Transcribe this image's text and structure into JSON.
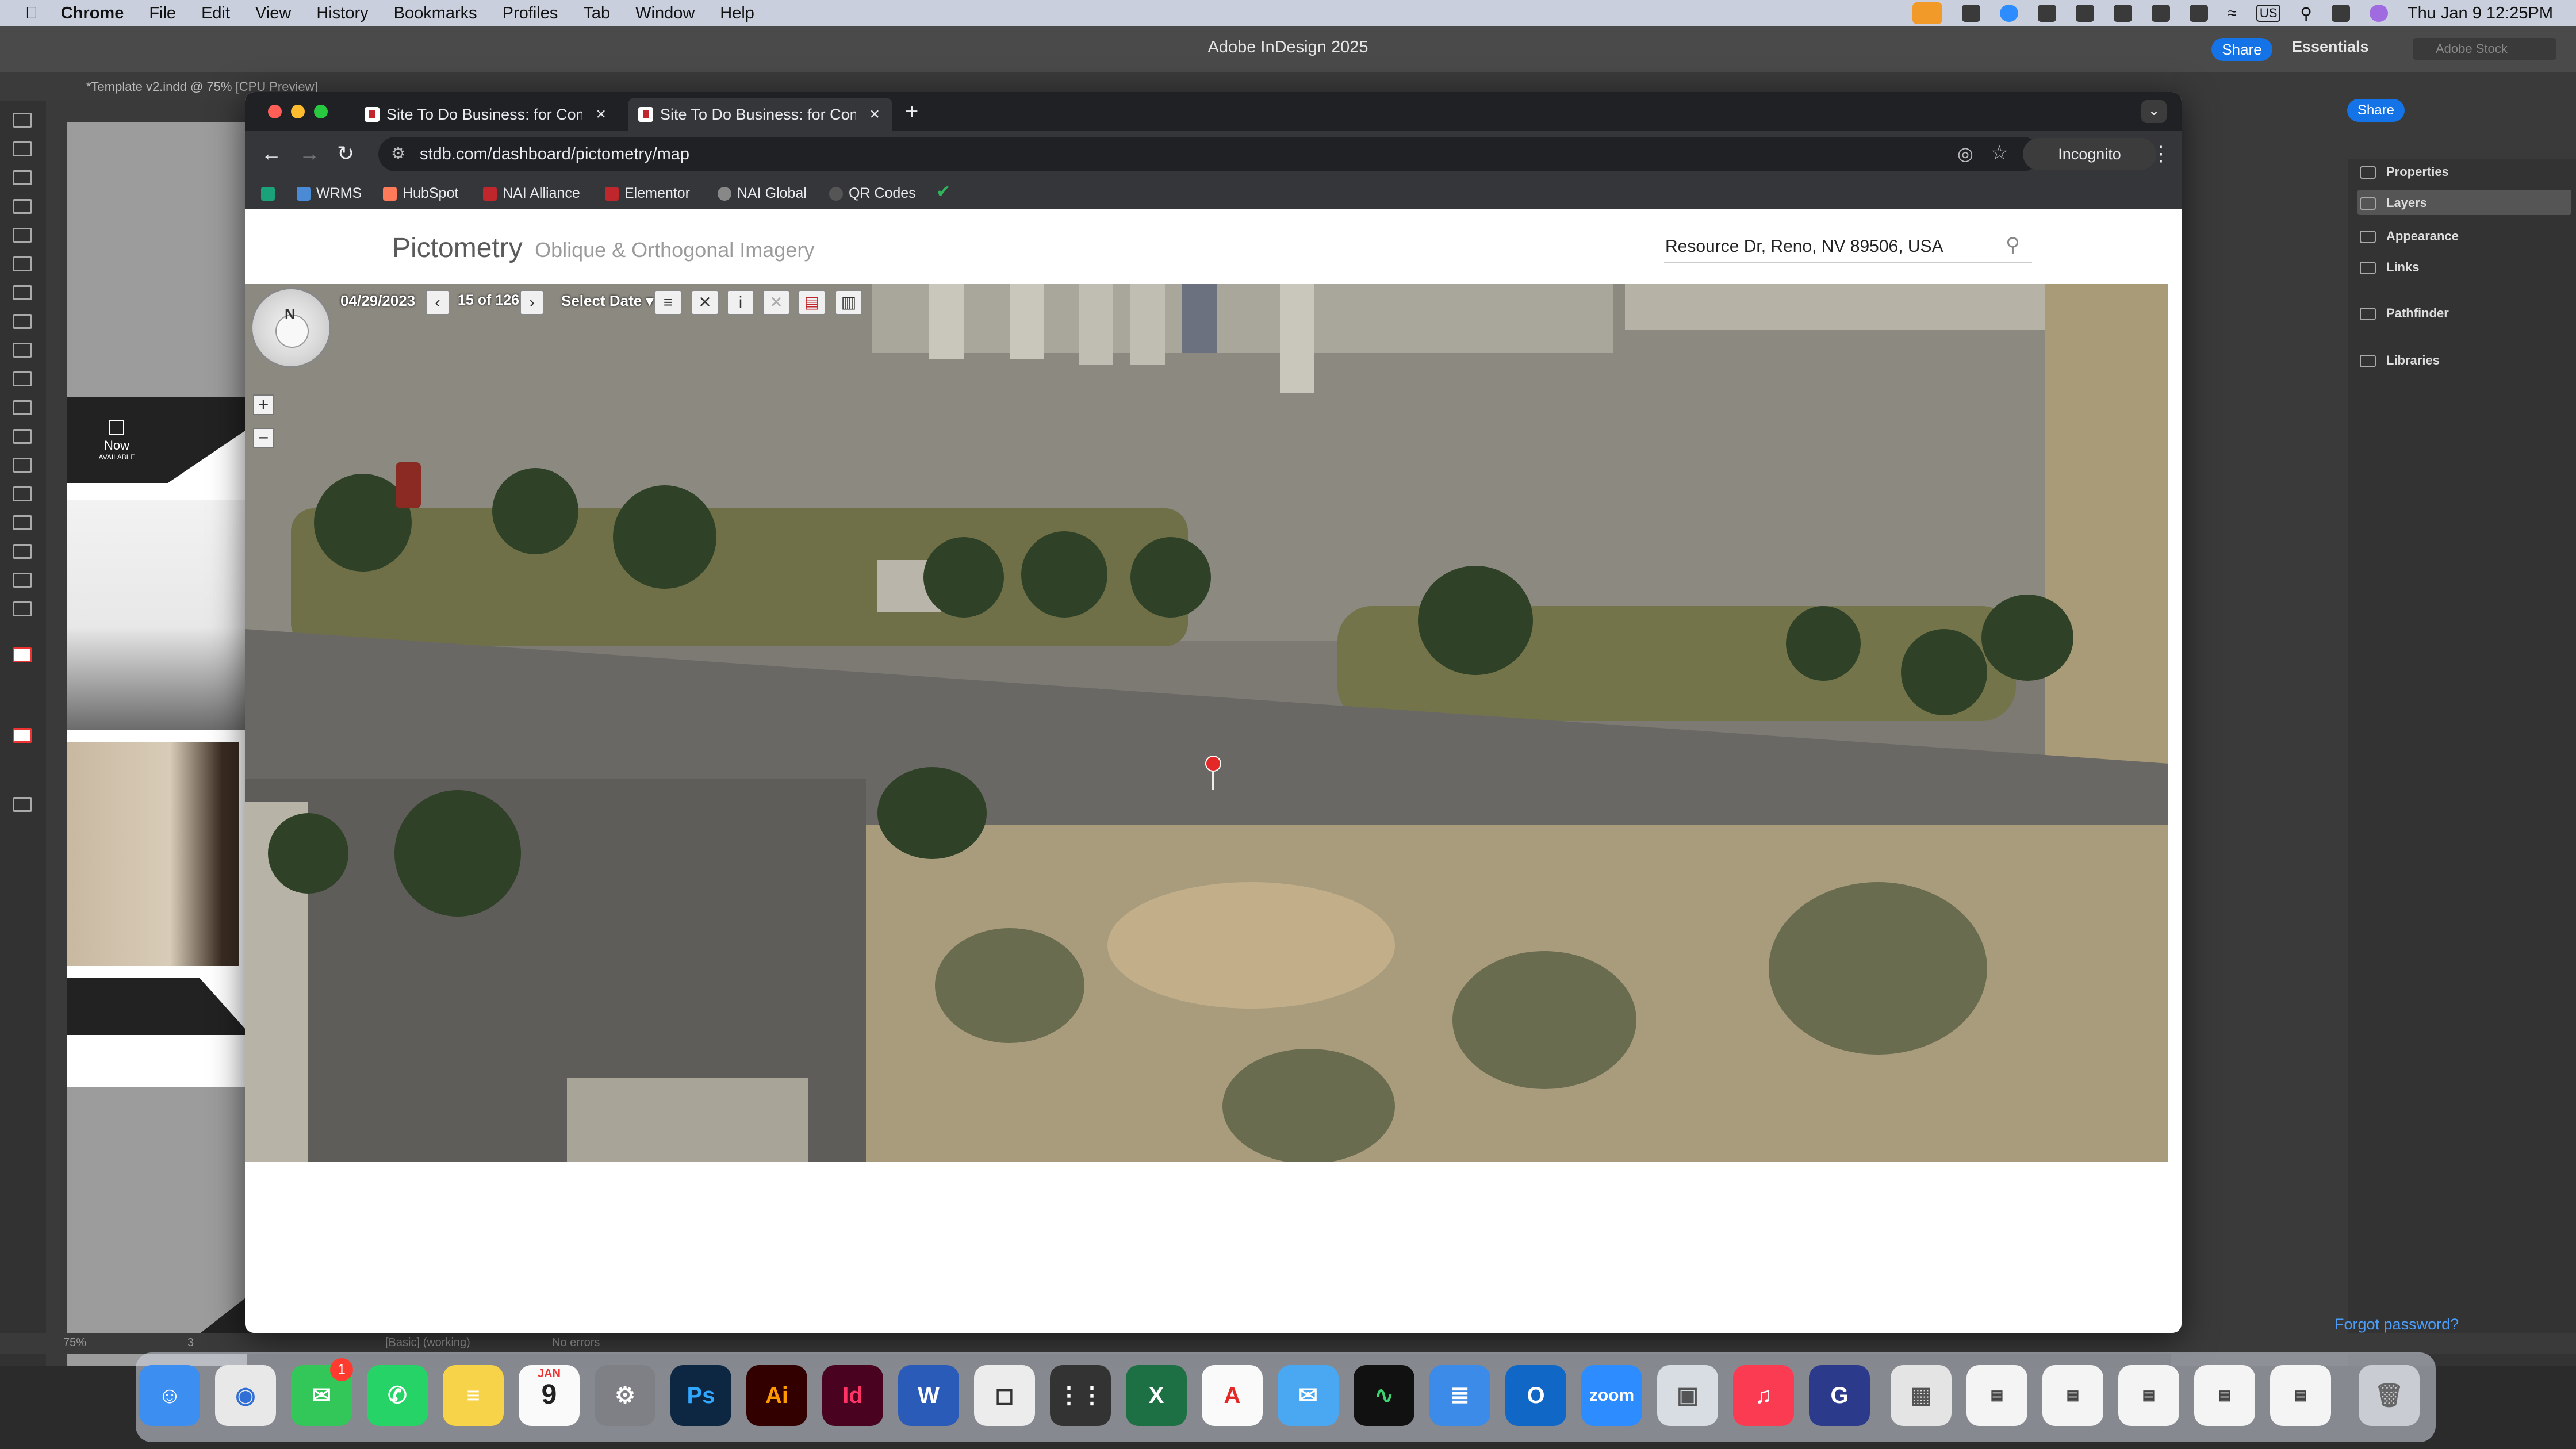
{
  "menubar": {
    "app": "Chrome",
    "items": [
      "File",
      "Edit",
      "View",
      "History",
      "Bookmarks",
      "Profiles",
      "Tab",
      "Window",
      "Help"
    ],
    "clock": "Thu Jan 9  12:25PM",
    "input_source": "US"
  },
  "indesign": {
    "title": "Adobe InDesign 2025",
    "share": "Share",
    "workspace": "Essentials",
    "stock_placeholder": "Adobe Stock",
    "doc_tab": "*Template v2.indd @ 75% [CPU Preview]",
    "share_panel": "Share",
    "panels": [
      "Properties",
      "Layers",
      "Appearance",
      "Links",
      "Pathfinder",
      "Libraries"
    ],
    "now_label": "Now",
    "now_sub": "AVAILABLE",
    "status": {
      "zoom": "75%",
      "page": "3",
      "style": "[Basic] (working)",
      "errors": "No errors"
    },
    "forgot": "Forgot password?"
  },
  "chrome": {
    "tabs": [
      {
        "label": "Site To Do Business: for Commercial Real Estate",
        "active": false
      },
      {
        "label": "Site To Do Business: for Commercial Real Estate",
        "active": true
      }
    ],
    "url": "stdb.com/dashboard/pictometry/map",
    "incognito": "Incognito",
    "bookmarks": [
      {
        "label": "",
        "color": "#1aa37a"
      },
      {
        "label": "WRMS",
        "color": "#4b8bd6"
      },
      {
        "label": "HubSpot",
        "color": "#ff7a59"
      },
      {
        "label": "NAI Alliance",
        "color": "#c0272d"
      },
      {
        "label": "Elementor",
        "color": "#c0272d"
      },
      {
        "label": "NAI Global",
        "color": "#888888"
      },
      {
        "label": "QR Codes",
        "color": "#555555"
      },
      {
        "label": "",
        "color": "#2fb45a"
      }
    ]
  },
  "page": {
    "brand": "Pictometry",
    "brand_sub": "Oblique & Orthogonal Imagery",
    "search_value": "Resource Dr, Reno, NV 89506, USA",
    "map": {
      "compass_n": "N",
      "date": "04/29/2023",
      "count": "15 of 126",
      "select_date": "Select Date ▾",
      "zoom_in": "+",
      "zoom_out": "−"
    }
  },
  "dock": {
    "apps": [
      "Finder",
      "Chrome",
      "Messages",
      "WhatsApp",
      "Notes",
      "Calendar",
      "System Settings",
      "Photoshop",
      "Illustrator",
      "InDesign",
      "Word",
      "Screenshot",
      "Calculator",
      "Excel",
      "Acrobat",
      "Mail",
      "Activity Monitor",
      "Docs",
      "Outlook",
      "Zoom",
      "Preview",
      "Music",
      "Grammarly",
      "Archive",
      "Window1",
      "Window2",
      "Window3",
      "Window4",
      "Window5",
      "Trash"
    ],
    "calendar_month": "JAN",
    "calendar_day": "9",
    "messages_badge": "1"
  },
  "colors": {
    "accent": "#1473e6",
    "pin": "#e42828",
    "chrome_dark": "#202124"
  }
}
